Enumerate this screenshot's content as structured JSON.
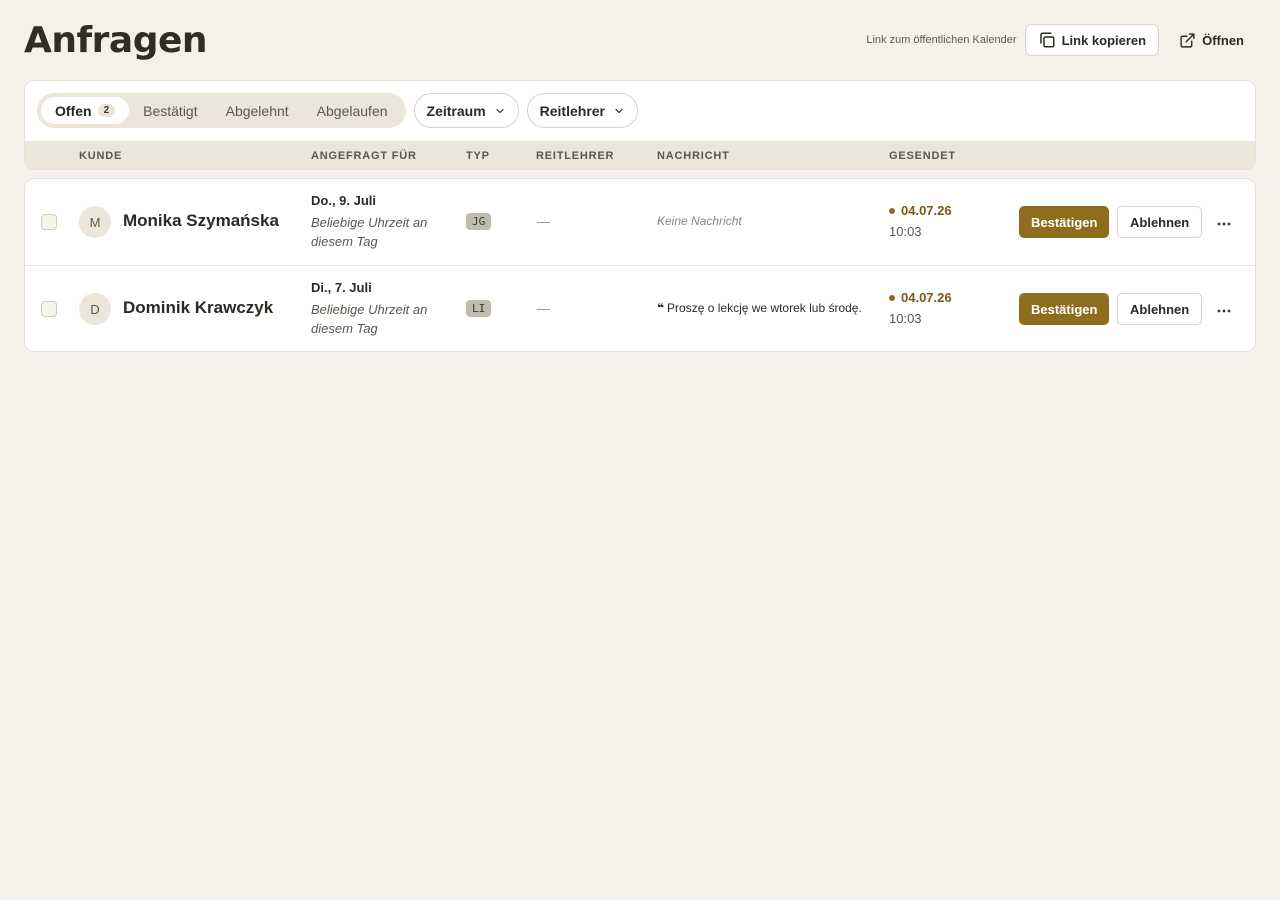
{
  "header": {
    "title": "Anfragen",
    "public_link_label": "Link zum öffentlichen Kalender",
    "copy_link_label": "Link kopieren",
    "open_label": "Öffnen"
  },
  "filters": {
    "tabs": [
      {
        "label": "Offen",
        "count": "2",
        "active": true
      },
      {
        "label": "Bestätigt"
      },
      {
        "label": "Abgelehnt"
      },
      {
        "label": "Abgelaufen"
      }
    ],
    "dropdowns": {
      "period": "Zeitraum",
      "instructor": "Reitlehrer"
    }
  },
  "table": {
    "columns": {
      "customer": "KUNDE",
      "requested_for": "ANGEFRAGT FÜR",
      "type": "TYP",
      "instructor": "REITLEHRER",
      "message": "NACHRICHT",
      "sent": "GESENDET"
    },
    "rows": [
      {
        "avatar_initial": "M",
        "customer": "Monika Szymańska",
        "date": "Do., 9. Juli",
        "time": "Beliebige Uhrzeit an diesem Tag",
        "type": "JG",
        "instructor": "—",
        "message": "Keine Nachricht",
        "has_message": false,
        "sent_date": "04.07.26",
        "sent_time": "10:03",
        "confirm_label": "Bestätigen",
        "reject_label": "Ablehnen"
      },
      {
        "avatar_initial": "D",
        "customer": "Dominik Krawczyk",
        "date": "Di., 7. Juli",
        "time": "Beliebige Uhrzeit an diesem Tag",
        "type": "LI",
        "instructor": "—",
        "message": "Proszę o lekcję we wtorek lub środę.",
        "quote_mark": "❝",
        "has_message": true,
        "sent_date": "04.07.26",
        "sent_time": "10:03",
        "confirm_label": "Bestätigen",
        "reject_label": "Ablehnen"
      }
    ]
  },
  "colors": {
    "background": "#f4f1ea",
    "accent": "#8f6d1f",
    "sent_accent": "#7a5a14",
    "table_header": "#ece6da"
  },
  "icons": {
    "copy": "copy-icon",
    "open": "external-link-icon",
    "chevron": "chevron-down-icon",
    "more": "more-horizontal-icon"
  }
}
